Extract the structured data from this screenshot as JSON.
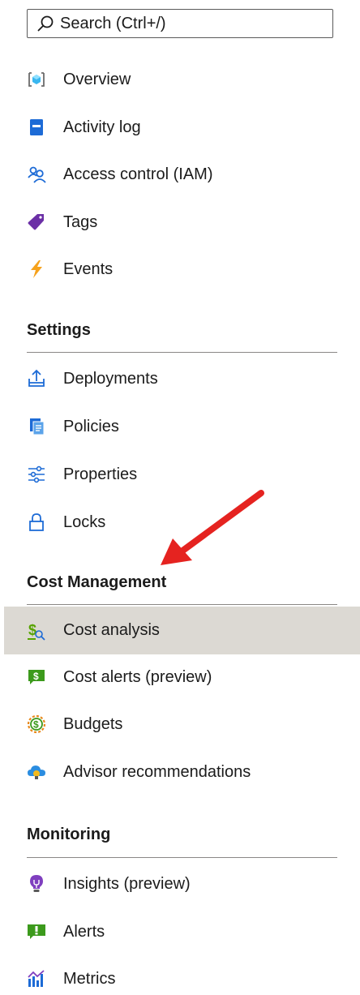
{
  "search": {
    "placeholder": "Search (Ctrl+/)",
    "icon": "search-icon"
  },
  "top_items": [
    {
      "label": "Overview",
      "icon": "overview-icon"
    },
    {
      "label": "Activity log",
      "icon": "activity-log-icon"
    },
    {
      "label": "Access control (IAM)",
      "icon": "access-control-icon"
    },
    {
      "label": "Tags",
      "icon": "tag-icon"
    },
    {
      "label": "Events",
      "icon": "events-icon"
    }
  ],
  "sections": [
    {
      "title": "Settings",
      "items": [
        {
          "label": "Deployments",
          "icon": "deployments-icon"
        },
        {
          "label": "Policies",
          "icon": "policies-icon"
        },
        {
          "label": "Properties",
          "icon": "properties-icon"
        },
        {
          "label": "Locks",
          "icon": "lock-icon"
        }
      ]
    },
    {
      "title": "Cost Management",
      "items": [
        {
          "label": "Cost analysis",
          "icon": "cost-analysis-icon",
          "selected": true
        },
        {
          "label": "Cost alerts (preview)",
          "icon": "cost-alerts-icon"
        },
        {
          "label": "Budgets",
          "icon": "budgets-icon"
        },
        {
          "label": "Advisor recommendations",
          "icon": "advisor-icon"
        }
      ]
    },
    {
      "title": "Monitoring",
      "items": [
        {
          "label": "Insights (preview)",
          "icon": "insights-icon"
        },
        {
          "label": "Alerts",
          "icon": "alerts-icon"
        },
        {
          "label": "Metrics",
          "icon": "metrics-icon"
        }
      ]
    }
  ],
  "colors": {
    "selected_background": "#dcd9d3",
    "annotation_arrow": "#e52320",
    "accent_blue": "#0078d4"
  }
}
